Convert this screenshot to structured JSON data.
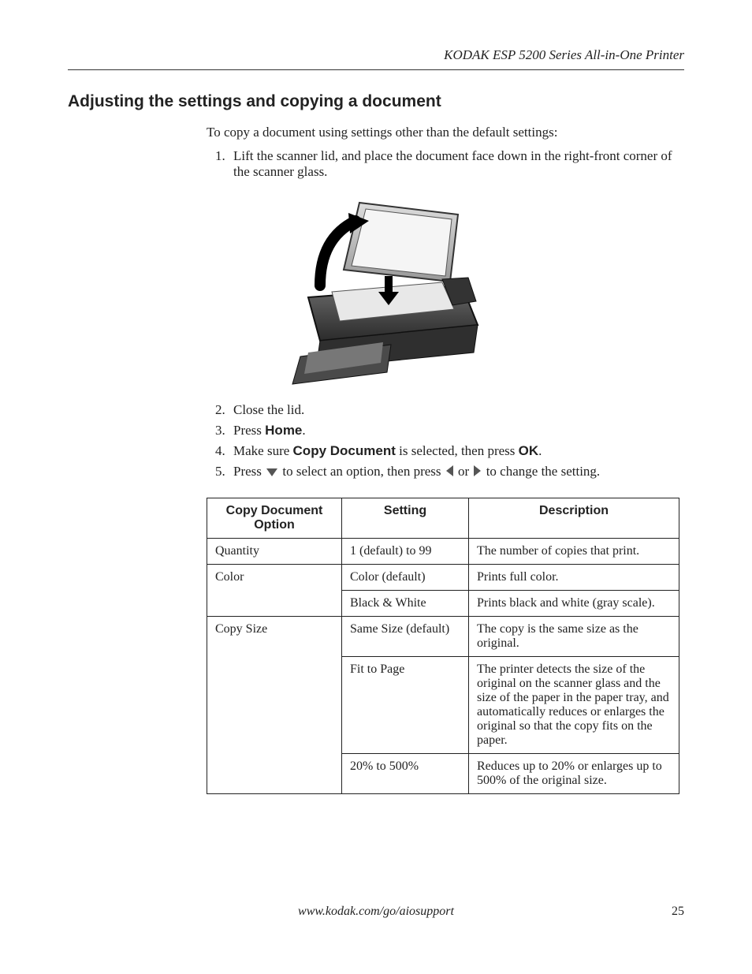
{
  "header": {
    "running_head": "KODAK ESP 5200 Series All-in-One Printer"
  },
  "section": {
    "title": "Adjusting the settings and copying a document",
    "intro": "To copy a document using settings other than the default settings:",
    "steps": {
      "s1": "Lift the scanner lid, and place the document face down in the right-front corner of the scanner glass.",
      "s2": "Close the lid.",
      "s3_pre": "Press ",
      "s3_bold": "Home",
      "s3_post": ".",
      "s4_pre": "Make sure ",
      "s4_bold": "Copy Document",
      "s4_mid": " is selected, then press ",
      "s4_bold2": "OK",
      "s4_post": ".",
      "s5_pre": "Press ",
      "s5_mid": " to select an option, then press ",
      "s5_or": " or ",
      "s5_post": "  to change the setting."
    }
  },
  "table": {
    "headers": {
      "h1": "Copy Document Option",
      "h2": "Setting",
      "h3": "Description"
    },
    "rows": {
      "quantity": {
        "option": "Quantity",
        "setting": "1 (default) to 99",
        "desc": "The number of copies that print."
      },
      "color": {
        "option": "Color",
        "setting1": "Color (default)",
        "desc1": "Prints full color.",
        "setting2": "Black & White",
        "desc2": "Prints black and white (gray scale)."
      },
      "copysize": {
        "option": "Copy Size",
        "setting1": "Same Size (default)",
        "desc1": "The copy is the same size as the original.",
        "setting2": "Fit to Page",
        "desc2": "The printer detects the size of the original on the scanner glass and the size of the paper in the paper tray, and automatically reduces or enlarges the original so that the copy fits on the paper.",
        "setting3": "20% to 500%",
        "desc3": "Reduces up to 20% or enlarges up to 500% of the original size."
      }
    }
  },
  "footer": {
    "url": "www.kodak.com/go/aiosupport",
    "page": "25"
  }
}
